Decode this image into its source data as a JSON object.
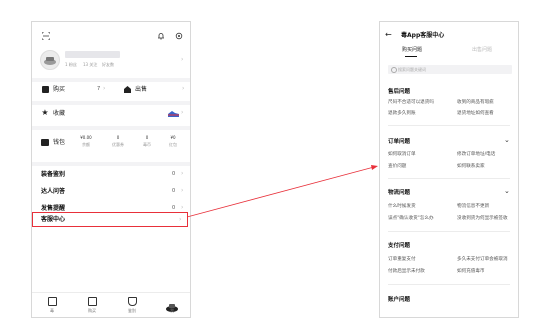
{
  "left": {
    "profile": {
      "sub1": "1 粉丝",
      "sub2": "13 关注",
      "sub3": "好友数"
    },
    "purchase": {
      "label": "购买",
      "count": "7"
    },
    "sell": {
      "label": "出售"
    },
    "favorites": {
      "label": "收藏"
    },
    "wallet": {
      "label": "钱包",
      "stats": [
        {
          "value": "¥0.00",
          "label": "余额"
        },
        {
          "value": "0",
          "label": "优惠券"
        },
        {
          "value": "0",
          "label": "毒币"
        },
        {
          "value": "¥0",
          "label": "红包"
        }
      ]
    },
    "menu": [
      {
        "label": "装备鉴别",
        "count": "0"
      },
      {
        "label": "达人问答",
        "count": "0"
      },
      {
        "label": "发售提醒",
        "count": "0"
      },
      {
        "label": "客服中心",
        "count": ""
      }
    ],
    "nav": [
      {
        "label": "毒"
      },
      {
        "label": "购买"
      },
      {
        "label": "鉴别"
      },
      {
        "label": "我"
      }
    ]
  },
  "right": {
    "header": {
      "title": "毒App客服中心"
    },
    "tabs": [
      {
        "label": "购买问题",
        "active": true
      },
      {
        "label": "出售问题",
        "active": false
      }
    ],
    "search": {
      "placeholder": "搜索问题关键词"
    },
    "sections": [
      {
        "title": "售后问题",
        "items": [
          "尺码不合适可以退货吗",
          "收到的商品有瑕疵",
          "退款多久到账",
          "退货地址如何查看"
        ]
      },
      {
        "title": "订单问题",
        "items": [
          "如何取消订单",
          "修改订单地址/电话",
          "查价问题",
          "如何联系卖家"
        ]
      },
      {
        "title": "物流问题",
        "items": [
          "什么时候发货",
          "物流信息不更新",
          "误点\"确认收货\"怎么办",
          "没收到货为何显示被签收"
        ]
      },
      {
        "title": "支付问题",
        "items": [
          "订单重复支付",
          "多久未支付订单会被取消",
          "付款后显示未付款",
          "如何充值毒币"
        ]
      },
      {
        "title": "账户问题",
        "items": []
      }
    ]
  },
  "colors": {
    "highlight": "#e8303a",
    "accent": "#1a1a1a"
  }
}
